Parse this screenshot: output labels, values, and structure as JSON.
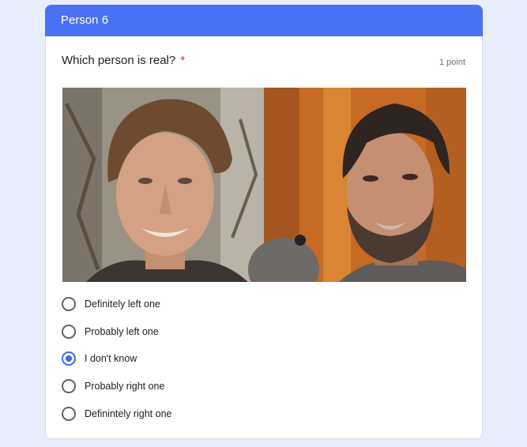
{
  "section": {
    "title": "Person 6"
  },
  "question": {
    "text": "Which person is real?",
    "required_marker": "*",
    "points": "1 point",
    "image": {
      "left_icon": "face-photo-icon",
      "right_icon": "face-photo-icon"
    }
  },
  "options": [
    {
      "label": "Definitely left one",
      "checked": false
    },
    {
      "label": "Probably left one",
      "checked": false
    },
    {
      "label": "I don't know",
      "checked": true
    },
    {
      "label": "Probably right one",
      "checked": false
    },
    {
      "label": "Definintely right one",
      "checked": false
    }
  ],
  "colors": {
    "header": "#4a72f5",
    "selected": "#3f6ce8",
    "required": "#d93025",
    "background": "#e8eefb"
  }
}
